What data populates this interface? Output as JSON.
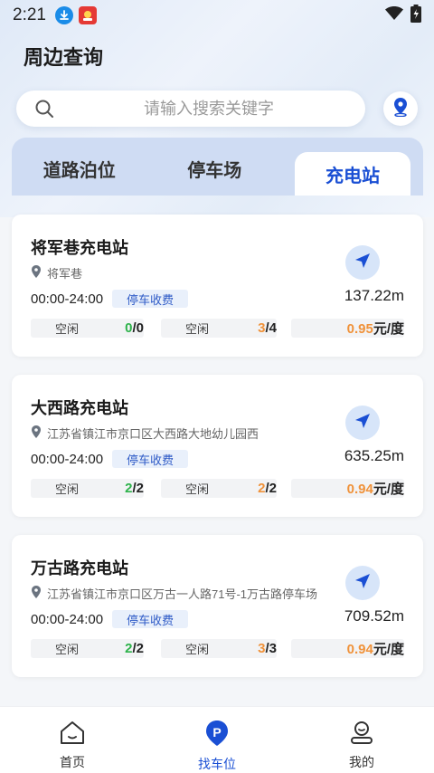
{
  "status_bar": {
    "time": "2:21",
    "icons": [
      "download-icon",
      "app-badge-icon",
      "wifi-icon",
      "battery-charging-icon"
    ]
  },
  "page_title": "周边查询",
  "search": {
    "placeholder": "请输入搜索关键字",
    "value": ""
  },
  "tabs": [
    {
      "label": "道路泊位",
      "active": false
    },
    {
      "label": "停车场",
      "active": false
    },
    {
      "label": "充电站",
      "active": true
    }
  ],
  "stations": [
    {
      "name": "将军巷充电站",
      "address": "将军巷",
      "hours": "00:00-24:00",
      "fee_tag": "停车收费",
      "distance": "137.22m",
      "slot1": {
        "label": "空闲",
        "available": "0",
        "total": "/0"
      },
      "slot2": {
        "label": "空闲",
        "available": "3",
        "total": "/4"
      },
      "price": {
        "value": "0.95",
        "unit": "元/度"
      }
    },
    {
      "name": "大西路充电站",
      "address": "江苏省镇江市京口区大西路大地幼儿园西",
      "hours": "00:00-24:00",
      "fee_tag": "停车收费",
      "distance": "635.25m",
      "slot1": {
        "label": "空闲",
        "available": "2",
        "total": "/2"
      },
      "slot2": {
        "label": "空闲",
        "available": "2",
        "total": "/2"
      },
      "price": {
        "value": "0.94",
        "unit": "元/度"
      }
    },
    {
      "name": "万古路充电站",
      "address": "江苏省镇江市京口区万古一人路71号-1万古路停车场",
      "hours": "00:00-24:00",
      "fee_tag": "停车收费",
      "distance": "709.52m",
      "slot1": {
        "label": "空闲",
        "available": "2",
        "total": "/2"
      },
      "slot2": {
        "label": "空闲",
        "available": "3",
        "total": "/3"
      },
      "price": {
        "value": "0.94",
        "unit": "元/度"
      }
    }
  ],
  "bottom_nav": [
    {
      "label": "首页",
      "icon": "home-icon",
      "active": false
    },
    {
      "label": "找车位",
      "icon": "parking-icon",
      "active": true
    },
    {
      "label": "我的",
      "icon": "user-icon",
      "active": false
    }
  ],
  "colors": {
    "accent": "#1a4fd4",
    "available_green": "#2db24a",
    "count_orange": "#f0923a"
  }
}
